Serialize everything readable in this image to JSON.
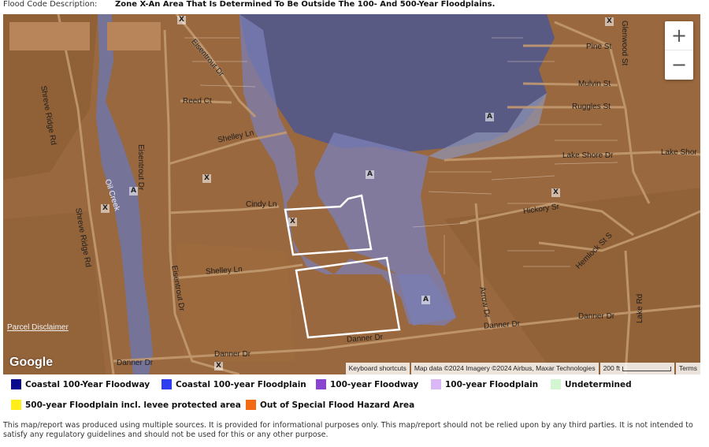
{
  "description": {
    "label": "Flood Code Description:",
    "value": "Zone X-An Area That Is Determined To Be Outside The 100- And 500-Year Floodplains."
  },
  "map": {
    "zoom_in": "+",
    "zoom_out": "−",
    "google": "Google",
    "parcel_disclaimer": "Parcel Disclaimer",
    "attribution": {
      "shortcuts": "Keyboard shortcuts",
      "data": "Map data ©2024 Imagery ©2024 Airbus, Maxar Technologies",
      "scale": "200 ft",
      "terms": "Terms"
    },
    "roads": {
      "eisentrout_top": "Eisentrout Dr",
      "reed": "Reed Ct",
      "shelley_top": "Shelley Ln",
      "eisentrout_left": "Eisentrout Dr",
      "eisentrout_bottom": "Eisentrout Dr",
      "shreve_top": "Shreve Ridge Rd",
      "shreve_bottom": "Shreve Ridge Rd",
      "oil_creek": "Oil Creek",
      "cindy": "Cindy Ln",
      "shelley_bottom": "Shelley Ln",
      "danner_left": "Danner Dr",
      "danner_mid": "Danner Dr",
      "danner_center": "Danner Dr",
      "danner_right_mid": "Danner Dr",
      "danner_right": "Danner Dr",
      "pine": "Pine St",
      "mulvin": "Mulvin St",
      "ruggles": "Ruggles St",
      "lake_shore": "Lake Shore Dr",
      "lake_shore_right": "Lake Shor",
      "hickory": "Hickory Sr",
      "hemlock": "Hemlock St S",
      "arrow": "Arrow Dr",
      "glenwood": "Glenwood St",
      "lake_rd": "Lake Rd"
    },
    "zone_marks": {
      "x": "X",
      "a": "A"
    }
  },
  "legend": [
    {
      "label": "Coastal 100-Year Floodway",
      "color": "#0a0a8c"
    },
    {
      "label": "Coastal 100-year Floodplain",
      "color": "#2d3df0"
    },
    {
      "label": "100-year Floodway",
      "color": "#8a45d0"
    },
    {
      "label": "100-year Floodplain",
      "color": "#d9b8f5"
    },
    {
      "label": "Undetermined",
      "color": "#d3f5d1"
    },
    {
      "label": "500-year Floodplain incl. levee protected area",
      "color": "#ffee1a"
    },
    {
      "label": "Out of Special Flood Hazard Area",
      "color": "#f26b14"
    }
  ],
  "disclaimer": "This map/report was produced using multiple sources. It is provided for informational purposes only. This map/report should not be relied upon by any third parties. It is not intended to satisfy any regulatory guidelines and should not be used for this or any other purpose."
}
